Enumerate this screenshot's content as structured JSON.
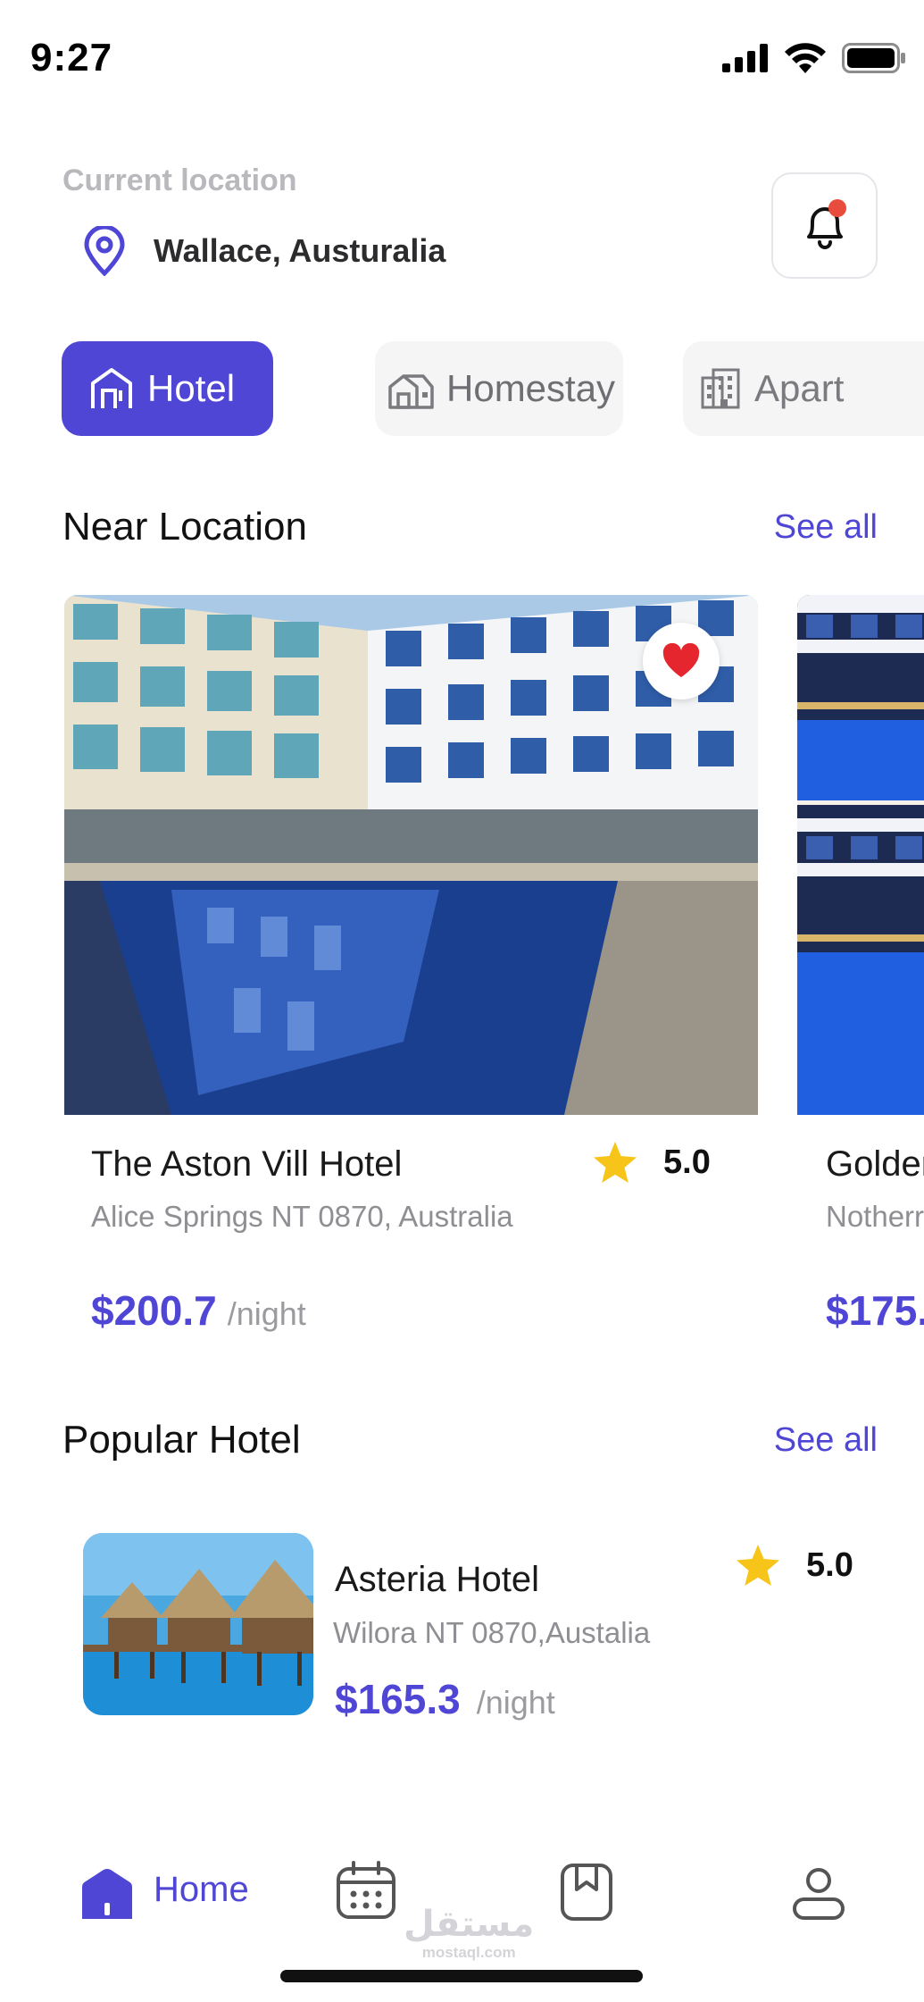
{
  "status_bar": {
    "time": "9:27"
  },
  "header": {
    "current_location_label": "Current location",
    "location_name": "Wallace, Austuralia"
  },
  "categories": [
    {
      "label": "Hotel",
      "selected": true
    },
    {
      "label": "Homestay",
      "selected": false
    },
    {
      "label": "Apart",
      "selected": false
    }
  ],
  "near_location": {
    "title": "Near Location",
    "see_all": "See all",
    "cards": [
      {
        "name": "The Aston Vill Hotel",
        "address": "Alice Springs NT 0870, Australia",
        "rating": "5.0",
        "price": "$200.7",
        "unit": "/night",
        "favorite": true
      },
      {
        "name": "Golder",
        "address": "Notherr",
        "price": "$175."
      }
    ]
  },
  "popular_hotel": {
    "title": "Popular Hotel",
    "see_all": "See all",
    "items": [
      {
        "name": "Asteria Hotel",
        "address": "Wilora NT 0870,Austalia",
        "rating": "5.0",
        "price": "$165.3",
        "unit": "/night"
      }
    ]
  },
  "bottom_nav": {
    "home_label": "Home",
    "items": [
      "home-icon",
      "calendar-icon",
      "bookmark-icon",
      "profile-icon"
    ]
  },
  "watermark": {
    "arabic": "مستقل",
    "latin": "mostaql.com"
  },
  "colors": {
    "accent": "#4f46d6",
    "star": "#f7c41a",
    "heart": "#e5262e",
    "notification_dot": "#e74c3c"
  }
}
